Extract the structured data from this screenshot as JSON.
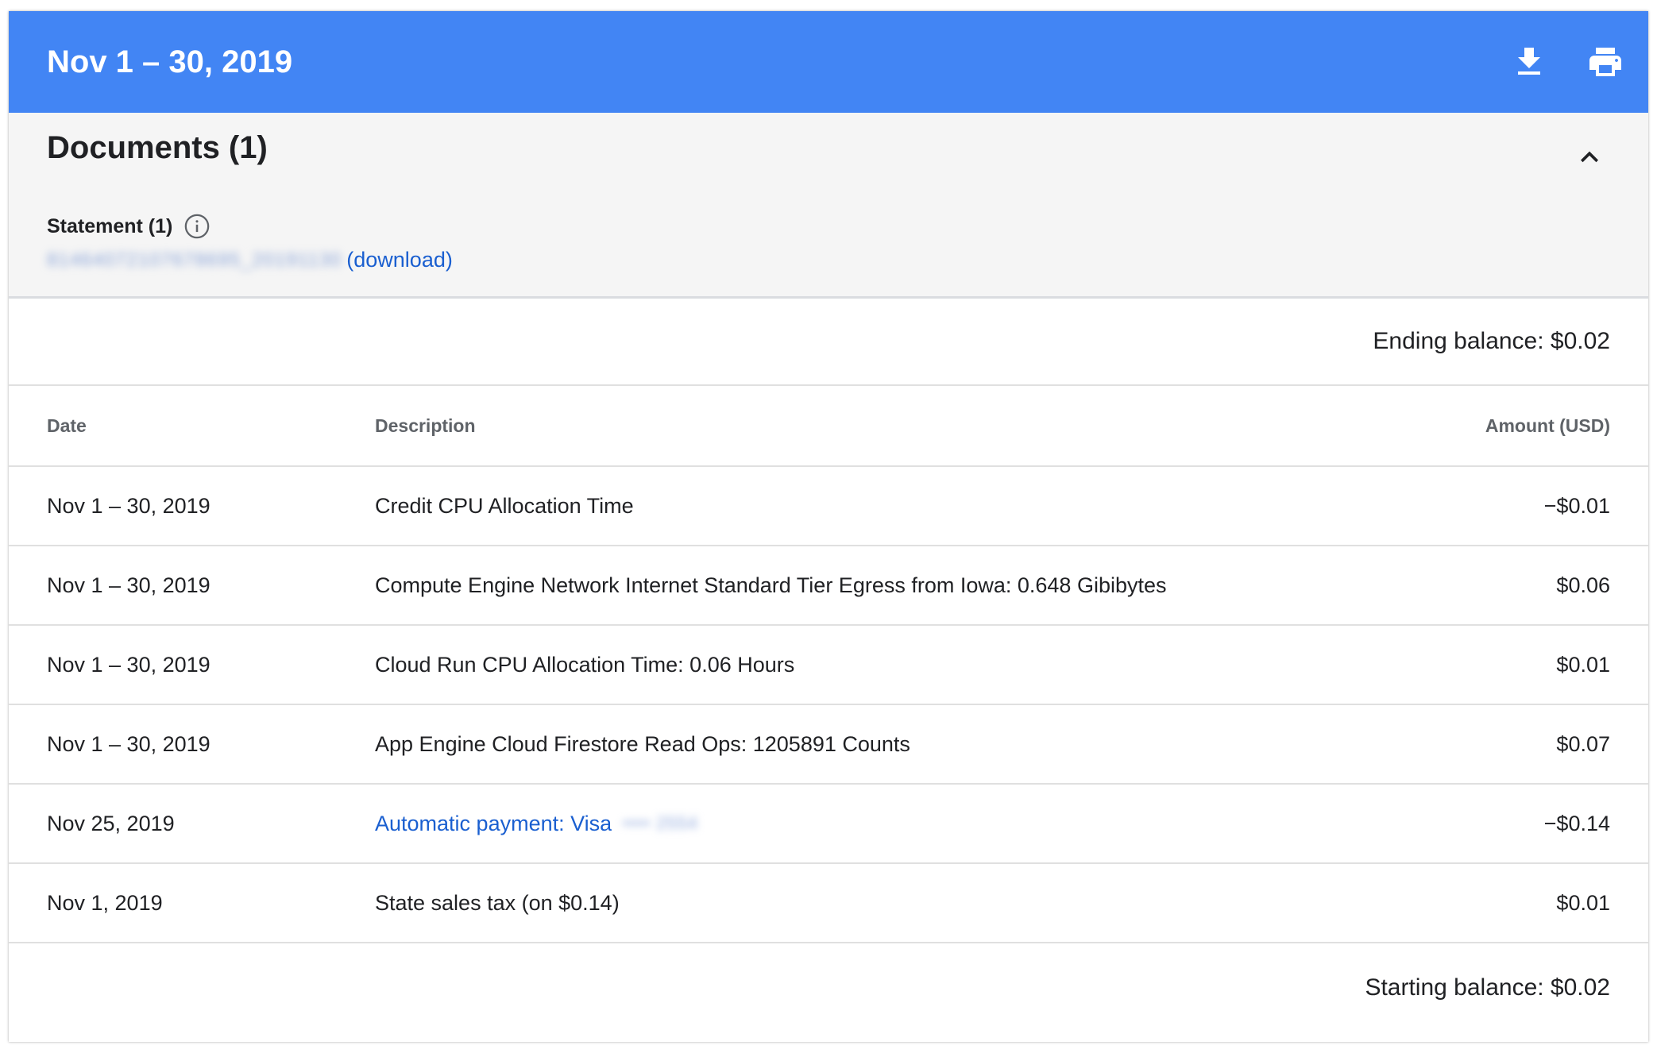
{
  "header": {
    "title": "Nov 1 – 30, 2019",
    "background_color": "#4285f4",
    "download_icon": "download-icon",
    "print_icon": "print-icon"
  },
  "documents": {
    "title": "Documents (1)",
    "statement_label": "Statement (1)",
    "statement_file_redacted": "81464072107678695_20191130",
    "download_link": "(download)"
  },
  "ending_balance": "Ending balance: $0.02",
  "table": {
    "headers": {
      "date": "Date",
      "description": "Description",
      "amount": "Amount (USD)"
    },
    "rows": [
      {
        "date": "Nov 1 – 30, 2019",
        "description": "Credit CPU Allocation Time",
        "amount": "−$0.01"
      },
      {
        "date": "Nov 1 – 30, 2019",
        "description": "Compute Engine Network Internet Standard Tier Egress from Iowa: 0.648 Gibibytes",
        "amount": "$0.06"
      },
      {
        "date": "Nov 1 – 30, 2019",
        "description": "Cloud Run CPU Allocation Time: 0.06 Hours",
        "amount": "$0.01"
      },
      {
        "date": "Nov 1 – 30, 2019",
        "description": "App Engine Cloud Firestore Read Ops: 1205891 Counts",
        "amount": "$0.07"
      },
      {
        "date": "Nov 25, 2019",
        "description": "Automatic payment: Visa",
        "description_redacted": "•••• 2554",
        "amount": "−$0.14"
      },
      {
        "date": "Nov 1, 2019",
        "description": "State sales tax (on $0.14)",
        "amount": "$0.01"
      }
    ]
  },
  "starting_balance": "Starting balance: $0.02"
}
